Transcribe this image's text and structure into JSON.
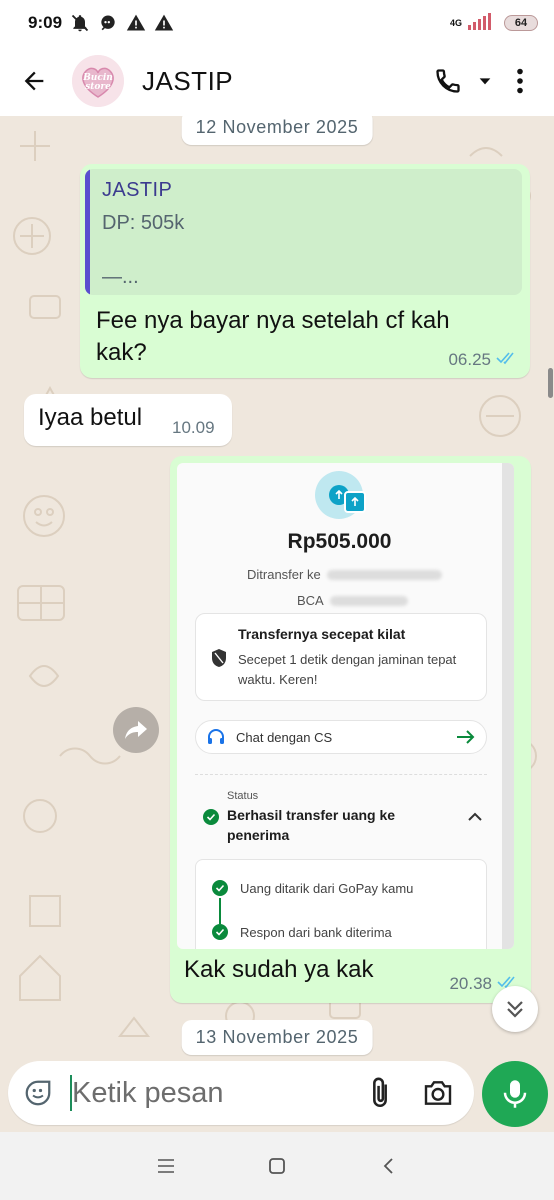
{
  "status_bar": {
    "time": "9:09",
    "network": "4G",
    "battery": "64",
    "icons": [
      "bell-off-icon",
      "chat-head-icon",
      "warning-icon",
      "warning-icon",
      "signal-icon",
      "battery-icon"
    ]
  },
  "header": {
    "avatar_text_line1": "Bucin",
    "avatar_text_line2": "store",
    "title": "JASTIP",
    "icons": [
      "back-arrow-icon",
      "phone-icon",
      "dropdown-icon",
      "more-vertical-icon"
    ]
  },
  "chat": {
    "dates": [
      "12 November 2025",
      "13 November 2025"
    ],
    "messages": [
      {
        "direction": "out",
        "quote": {
          "name": "JASTIP",
          "line": "DP: 505k",
          "more": "—..."
        },
        "text_line1": "Fee nya bayar nya setelah cf kah",
        "text_line2": "kak?",
        "time": "06.25",
        "status": "read"
      },
      {
        "direction": "in",
        "text": "Iyaa betul",
        "time": "10.09"
      },
      {
        "direction": "out",
        "image": {
          "amount": "Rp505.000",
          "transfer_to_label": "Ditransfer ke",
          "bank": "BCA",
          "card_title": "Transfernya secepat kilat",
          "card_desc": "Secepet 1 detik dengan jaminan tepat waktu. Keren!",
          "cs_label": "Chat dengan CS",
          "status_label": "Status",
          "status_value": "Berhasil transfer uang ke penerima",
          "steps": [
            "Uang ditarik dari GoPay kamu",
            "Respon dari bank diterima"
          ]
        },
        "text": "Kak sudah ya kak",
        "time": "20.38",
        "status": "read"
      }
    ]
  },
  "composer": {
    "placeholder": "Ketik pesan",
    "icons": [
      "sticker-icon",
      "attach-icon",
      "camera-icon",
      "mic-icon"
    ]
  },
  "nav": {
    "icons": [
      "recents-icon",
      "home-icon",
      "back-icon"
    ]
  },
  "colors": {
    "accent": "#1fa855",
    "bubble_out": "#d9fdd3",
    "bubble_in": "#ffffff",
    "chat_bg": "#efe7dd",
    "read_ticks": "#53bdeb"
  }
}
